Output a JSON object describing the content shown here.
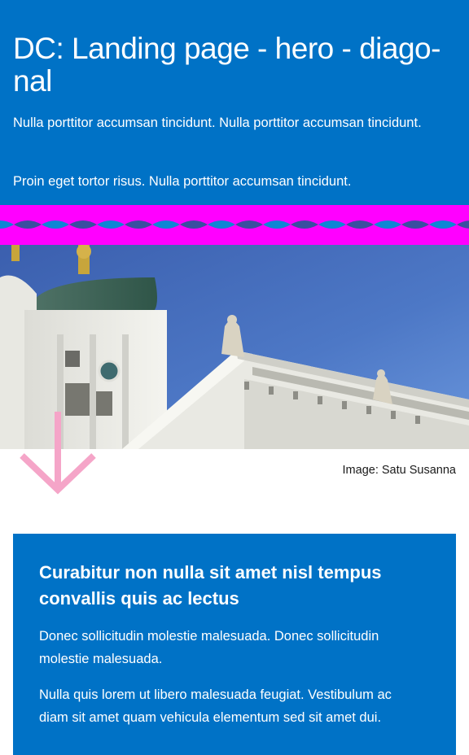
{
  "colors": {
    "brand_blue": "#0072c6",
    "koro_magenta": "#ff00ff",
    "wave_light": "#0e86d4",
    "wave_dark": "#3a4fa0",
    "arrow_pink": "#f5a5c8"
  },
  "hero": {
    "title": "DC: Landing page - hero - diago-nal",
    "paragraph_1": "Nulla porttitor accumsan tincidunt. Nulla porttitor accumsan tincidunt.",
    "paragraph_2": "Proin eget tortor risus. Nulla porttitor accumsan tincidunt."
  },
  "image": {
    "caption": "Image: Satu Susanna",
    "icon": "cathedral-photo"
  },
  "scroll_arrow": {
    "icon": "arrow-down-icon"
  },
  "content_card": {
    "title": "Curabitur non nulla sit amet nisl tempus convallis quis ac lectus",
    "paragraph_1": "Donec sollicitudin molestie malesuada. Donec sollicitudin molestie malesuada.",
    "paragraph_2": "Nulla quis lorem ut libero malesuada feugiat. Vestibulum ac diam sit amet quam vehicula elementum sed sit amet dui."
  }
}
